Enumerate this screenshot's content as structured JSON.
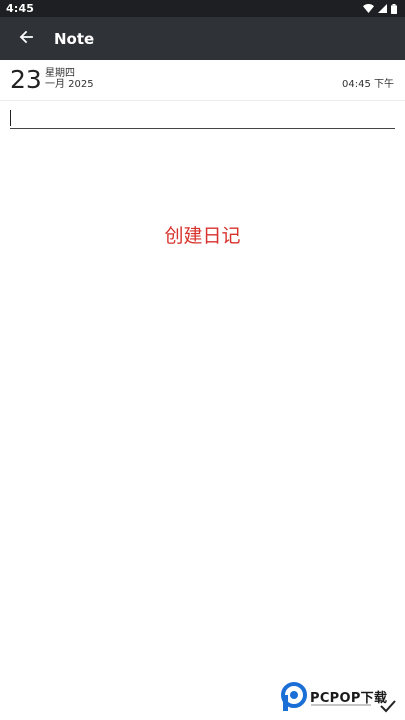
{
  "status_bar": {
    "time": "4:45",
    "icons": [
      "wifi-icon",
      "signal-icon",
      "battery-icon"
    ]
  },
  "app_bar": {
    "back_icon": "arrow-left-icon",
    "title": "Note"
  },
  "date_header": {
    "day": "23",
    "weekday": "星期四",
    "month_year": "一月 2025",
    "time": "04:45 下午"
  },
  "note_input": {
    "value": "",
    "placeholder": ""
  },
  "center_text": "创建日记",
  "confirm_icon": "check-icon",
  "watermark": {
    "text": "PCPOP下载"
  },
  "colors": {
    "status_bar_bg": "#1e1f22",
    "app_bar_bg": "#2f3237",
    "accent_text": "#d7322c",
    "watermark_blue": "#1a6fd6"
  }
}
